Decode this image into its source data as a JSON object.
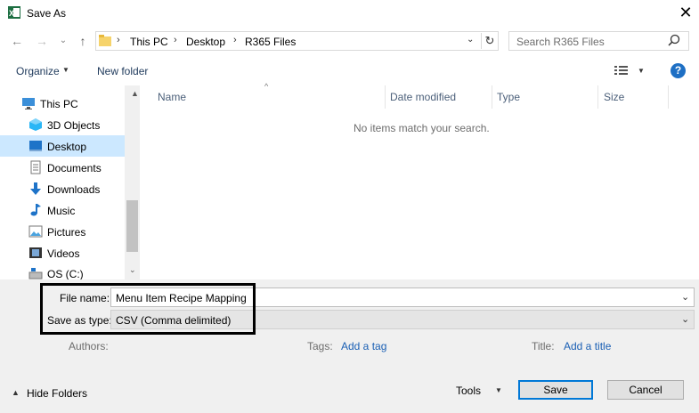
{
  "window": {
    "title": "Save As"
  },
  "address": {
    "crumbs": [
      "This PC",
      "Desktop",
      "R365 Files"
    ],
    "search_placeholder": "Search R365 Files"
  },
  "toolbar": {
    "organize": "Organize",
    "new_folder": "New folder",
    "help": "?"
  },
  "nav": {
    "items": [
      {
        "label": "This PC",
        "icon": "computer-icon"
      },
      {
        "label": "3D Objects",
        "icon": "cube-icon"
      },
      {
        "label": "Desktop",
        "icon": "desktop-icon",
        "selected": true
      },
      {
        "label": "Documents",
        "icon": "document-icon"
      },
      {
        "label": "Downloads",
        "icon": "download-icon"
      },
      {
        "label": "Music",
        "icon": "music-icon"
      },
      {
        "label": "Pictures",
        "icon": "picture-icon"
      },
      {
        "label": "Videos",
        "icon": "video-icon"
      },
      {
        "label": "OS (C:)",
        "icon": "drive-icon"
      }
    ]
  },
  "list": {
    "columns": [
      "Name",
      "Date modified",
      "Type",
      "Size"
    ],
    "empty_message": "No items match your search."
  },
  "form": {
    "file_name_label": "File name:",
    "file_name_value": "Menu Item Recipe Mapping",
    "save_type_label": "Save as type:",
    "save_type_value": "CSV (Comma delimited)",
    "authors_label": "Authors:",
    "tags_label": "Tags:",
    "tags_link": "Add a tag",
    "title_label": "Title:",
    "title_link": "Add a title"
  },
  "footer": {
    "hide_folders": "Hide Folders",
    "tools": "Tools",
    "save": "Save",
    "cancel": "Cancel"
  },
  "colors": {
    "accent": "#0078d7",
    "selection": "#cce8ff",
    "link": "#1a5fb4",
    "excel_green": "#1d6f42"
  }
}
